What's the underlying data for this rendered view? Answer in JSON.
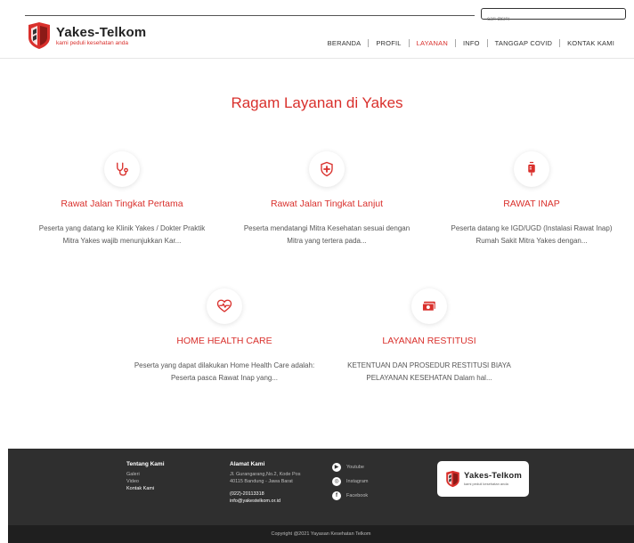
{
  "header": {
    "search_placeholder": "cari disini",
    "brand_name": "Yakes-Telkom",
    "brand_tagline": "kami peduli kesehatan anda",
    "nav": [
      {
        "label": "BERANDA",
        "active": false
      },
      {
        "label": "PROFIL",
        "active": false
      },
      {
        "label": "LAYANAN",
        "active": true
      },
      {
        "label": "INFO",
        "active": false
      },
      {
        "label": "TANGGAP COVID",
        "active": false
      },
      {
        "label": "KONTAK KAMI",
        "active": false
      }
    ]
  },
  "main": {
    "title": "Ragam Layanan di Yakes",
    "services": [
      {
        "icon": "stethoscope-icon",
        "title": "Rawat Jalan Tingkat Pertama",
        "desc": "Peserta yang datang ke Klinik Yakes / Dokter Praktik Mitra Yakes wajib menunjukkan Kar..."
      },
      {
        "icon": "shield-cross-icon",
        "title": "Rawat Jalan Tingkat Lanjut",
        "desc": "Peserta mendatangi Mitra Kesehatan sesuai dengan Mitra yang tertera pada..."
      },
      {
        "icon": "iv-bag-icon",
        "title": "RAWAT INAP",
        "desc": "Peserta datang ke IGD/UGD (Instalasi Rawat Inap) Rumah Sakit Mitra Yakes dengan..."
      },
      {
        "icon": "heart-pulse-icon",
        "title": "HOME HEALTH CARE",
        "desc": "Peserta yang dapat dilakukan Home Health Care adalah: Peserta pasca Rawat Inap yang..."
      },
      {
        "icon": "money-icon",
        "title": "LAYANAN RESTITUSI",
        "desc": "KETENTUAN DAN PROSEDUR RESTITUSI BIAYA PELAYANAN KESEHATAN Dalam hal..."
      }
    ]
  },
  "footer": {
    "about_title": "Tentang Kami",
    "about_links": [
      "Galeri",
      "Video",
      "Kontak Kami"
    ],
    "address_title": "Alamat Kami",
    "address_line1": "Jl. Gurangarang,No.2, Kode Pos",
    "address_line2": "40115 Bandung - Jawa Barat",
    "phone": "(022)-20113318",
    "email": "info@yakestelkom.or.id",
    "social": [
      {
        "icon": "youtube-icon",
        "label": "Youtube"
      },
      {
        "icon": "instagram-icon",
        "label": "Instagram"
      },
      {
        "icon": "facebook-icon",
        "label": "Facebook"
      }
    ],
    "logo_name": "Yakes-Telkom",
    "logo_tagline": "kami peduli kesehatan anda",
    "copyright": "Copyright @2021 Yayasan Kesehatan Telkom"
  },
  "colors": {
    "accent": "#d9302c",
    "footer_bg": "#2f2f2f",
    "footer_bottom_bg": "#1f1f1f"
  }
}
